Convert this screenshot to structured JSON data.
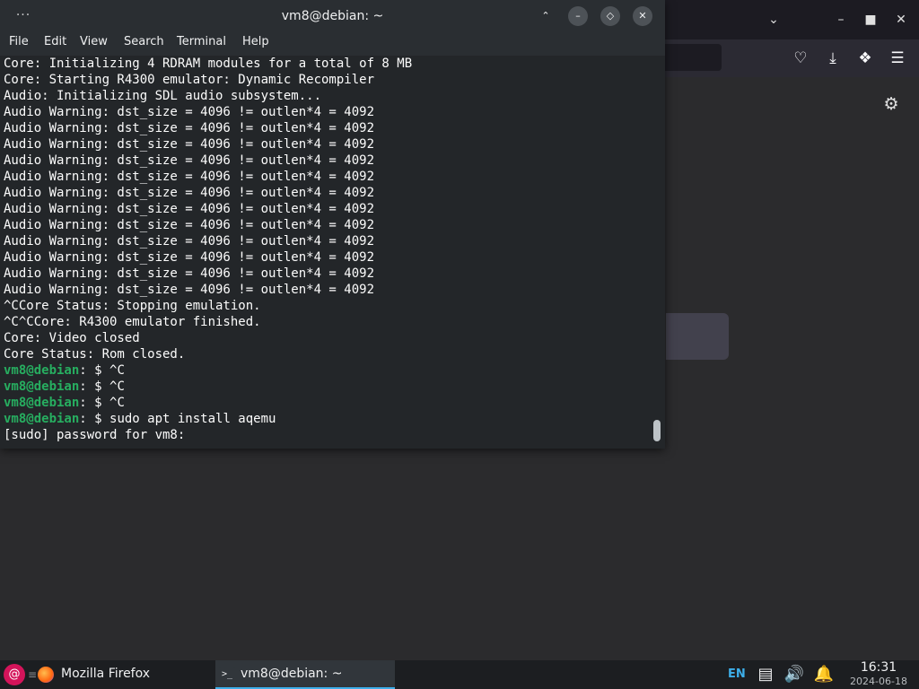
{
  "terminal": {
    "title": "vm8@debian: ~",
    "menu": [
      "File",
      "Edit",
      "View",
      "Search",
      "Terminal",
      "Help"
    ],
    "lines": [
      {
        "text": "Core: Initializing 4 RDRAM modules for a total of 8 MB"
      },
      {
        "text": "Core: Starting R4300 emulator: Dynamic Recompiler"
      },
      {
        "text": "Audio: Initializing SDL audio subsystem..."
      },
      {
        "text": "Audio Warning: dst_size = 4096 != outlen*4 = 4092"
      },
      {
        "text": "Audio Warning: dst_size = 4096 != outlen*4 = 4092"
      },
      {
        "text": "Audio Warning: dst_size = 4096 != outlen*4 = 4092"
      },
      {
        "text": "Audio Warning: dst_size = 4096 != outlen*4 = 4092"
      },
      {
        "text": "Audio Warning: dst_size = 4096 != outlen*4 = 4092"
      },
      {
        "text": "Audio Warning: dst_size = 4096 != outlen*4 = 4092"
      },
      {
        "text": "Audio Warning: dst_size = 4096 != outlen*4 = 4092"
      },
      {
        "text": "Audio Warning: dst_size = 4096 != outlen*4 = 4092"
      },
      {
        "text": "Audio Warning: dst_size = 4096 != outlen*4 = 4092"
      },
      {
        "text": "Audio Warning: dst_size = 4096 != outlen*4 = 4092"
      },
      {
        "text": "Audio Warning: dst_size = 4096 != outlen*4 = 4092"
      },
      {
        "text": "Audio Warning: dst_size = 4096 != outlen*4 = 4092"
      },
      {
        "text": "^CCore Status: Stopping emulation."
      },
      {
        "text": "^C^CCore: R4300 emulator finished."
      },
      {
        "text": "Core: Video closed"
      },
      {
        "text": "Core Status: Rom closed."
      },
      {
        "prompt": "vm8@debian",
        "text": ": $ ^C"
      },
      {
        "prompt": "vm8@debian",
        "text": ": $ ^C"
      },
      {
        "prompt": "vm8@debian",
        "text": ": $ ^C"
      },
      {
        "prompt": "vm8@debian",
        "text": ": $ sudo apt install aqemu"
      },
      {
        "text": "[sudo] password for vm8: "
      }
    ]
  },
  "taskbar": {
    "tasks": [
      {
        "label": "Mozilla Firefox",
        "icon": "firefox-icon"
      },
      {
        "label": "vm8@debian: ~",
        "icon": "terminal-icon"
      }
    ],
    "language": "EN",
    "time": "16:31",
    "date": "2024-06-18"
  },
  "colors": {
    "prompt": "#27ae60",
    "accent": "#3daee9",
    "terminal_bg": "#232629",
    "firefox_bg": "#2b2b2d"
  }
}
